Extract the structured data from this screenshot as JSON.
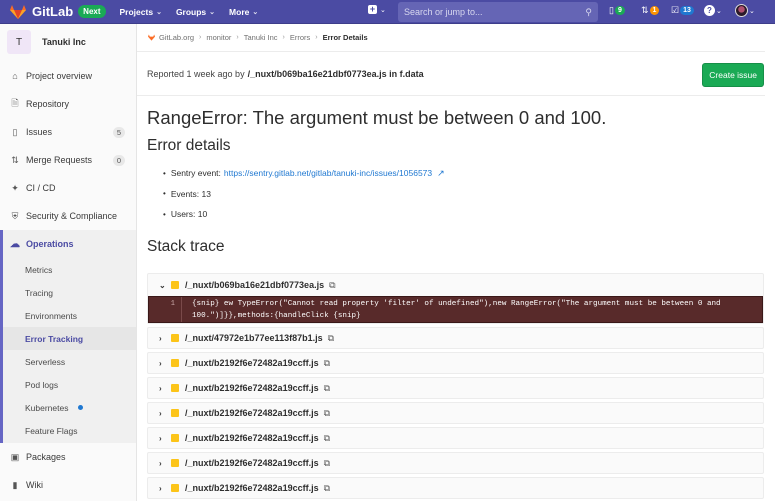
{
  "topbar": {
    "brand": "GitLab",
    "badge": "Next",
    "nav": [
      {
        "label": "Projects"
      },
      {
        "label": "Groups"
      },
      {
        "label": "More"
      }
    ],
    "search_placeholder": "Search or jump to...",
    "counters": {
      "issues": "9",
      "merge_requests": "1",
      "todos": "13"
    },
    "colors": {
      "bar": "#4b4ba3",
      "issues": "#1aaa55",
      "merge_requests": "#fc9403",
      "todos": "#1f78d1"
    }
  },
  "sidebar": {
    "project_initial": "T",
    "project_name": "Tanuki Inc",
    "items": [
      {
        "label": "Project overview",
        "icon": "home-icon"
      },
      {
        "label": "Repository",
        "icon": "doc-icon"
      },
      {
        "label": "Issues",
        "icon": "issues-icon",
        "count": "5"
      },
      {
        "label": "Merge Requests",
        "icon": "merge-request-icon",
        "count": "0"
      },
      {
        "label": "CI / CD",
        "icon": "rocket-icon"
      },
      {
        "label": "Security & Compliance",
        "icon": "shield-icon"
      }
    ],
    "operations": {
      "label": "Operations",
      "subitems": [
        {
          "label": "Metrics"
        },
        {
          "label": "Tracing"
        },
        {
          "label": "Environments"
        },
        {
          "label": "Error Tracking",
          "active": true
        },
        {
          "label": "Serverless"
        },
        {
          "label": "Pod logs"
        },
        {
          "label": "Kubernetes",
          "dot": true
        },
        {
          "label": "Feature Flags"
        }
      ]
    },
    "bottom_items": [
      {
        "label": "Packages",
        "icon": "package-icon"
      },
      {
        "label": "Wiki",
        "icon": "book-icon"
      }
    ]
  },
  "breadcrumb": [
    "GitLab.org",
    "monitor",
    "Tanuki Inc",
    "Errors",
    "Error Details"
  ],
  "header": {
    "reported_prefix": "Reported 1 week ago by",
    "reported_source": "/_nuxt/b069ba16e21dbf0773ea.js in f.data",
    "create_issue": "Create issue"
  },
  "error": {
    "title": "RangeError: The argument must be between 0 and 100.",
    "details_heading": "Error details",
    "sentry_label": "Sentry event:",
    "sentry_url": "https://sentry.gitlab.net/gitlab/tanuki-inc/issues/1056573",
    "events_label": "Events: 13",
    "users_label": "Users: 10",
    "stack_heading": "Stack trace"
  },
  "stack": {
    "expanded": {
      "file": "/_nuxt/b069ba16e21dbf0773ea.js",
      "line_number": "1",
      "code": "{snip} ew TypeError(\"Cannot read property 'filter' of undefined\"),new RangeError(\"The argument must be between 0 and 100.\")]}},methods:{handleClick {snip}"
    },
    "collapsed": [
      "/_nuxt/47972e1b77ee113f87b1.js",
      "/_nuxt/b2192f6e72482a19ccff.js",
      "/_nuxt/b2192f6e72482a19ccff.js",
      "/_nuxt/b2192f6e72482a19ccff.js",
      "/_nuxt/b2192f6e72482a19ccff.js",
      "/_nuxt/b2192f6e72482a19ccff.js",
      "/_nuxt/b2192f6e72482a19ccff.js"
    ]
  }
}
